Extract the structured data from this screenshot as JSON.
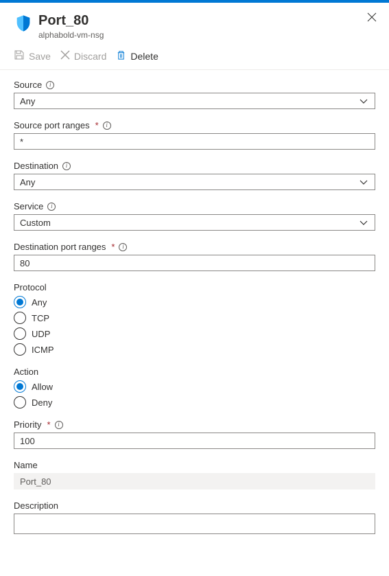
{
  "header": {
    "title": "Port_80",
    "subtitle": "alphabold-vm-nsg"
  },
  "toolbar": {
    "save_label": "Save",
    "discard_label": "Discard",
    "delete_label": "Delete"
  },
  "form": {
    "source": {
      "label": "Source",
      "value": "Any"
    },
    "source_port_ranges": {
      "label": "Source port ranges",
      "value": "*"
    },
    "destination": {
      "label": "Destination",
      "value": "Any"
    },
    "service": {
      "label": "Service",
      "value": "Custom"
    },
    "destination_port_ranges": {
      "label": "Destination port ranges",
      "value": "80"
    },
    "protocol": {
      "label": "Protocol",
      "options": {
        "any": "Any",
        "tcp": "TCP",
        "udp": "UDP",
        "icmp": "ICMP"
      },
      "selected": "any"
    },
    "action": {
      "label": "Action",
      "options": {
        "allow": "Allow",
        "deny": "Deny"
      },
      "selected": "allow"
    },
    "priority": {
      "label": "Priority",
      "value": "100"
    },
    "name": {
      "label": "Name",
      "value": "Port_80"
    },
    "description": {
      "label": "Description",
      "value": ""
    }
  }
}
